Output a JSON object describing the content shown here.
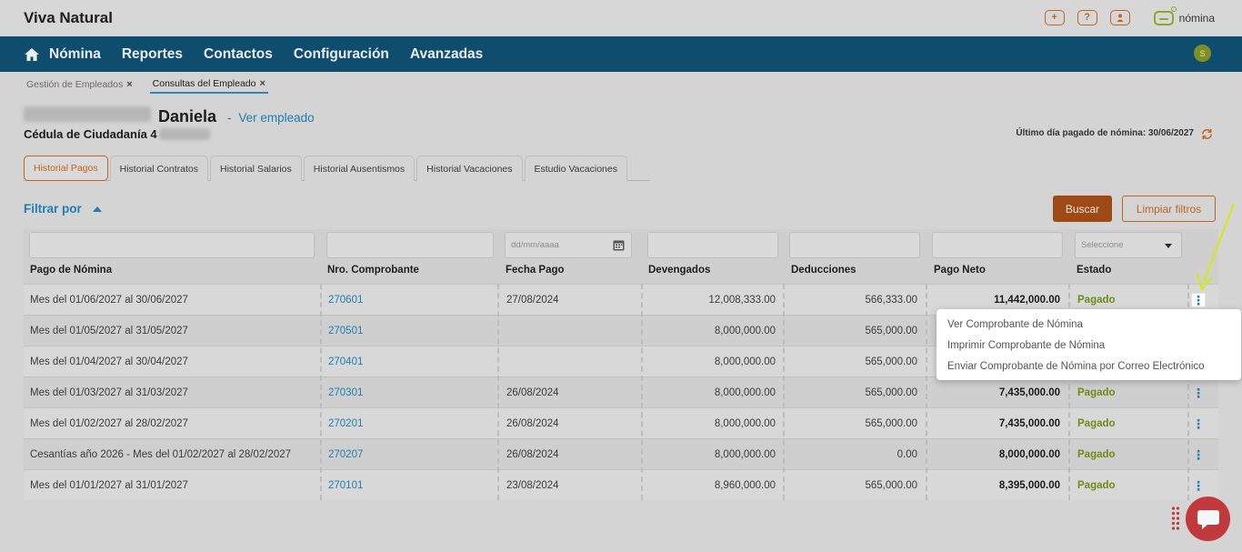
{
  "app": {
    "title": "Viva Natural",
    "product_label": "nómina"
  },
  "header_icons": [
    "plus-icon",
    "help-icon",
    "user-icon"
  ],
  "nav": {
    "items": [
      "Nómina",
      "Reportes",
      "Contactos",
      "Configuración",
      "Avanzadas"
    ],
    "badge": "S"
  },
  "breadcrumbs": [
    {
      "label": "Gestión de Empleados",
      "active": false
    },
    {
      "label": "Consultas del Empleado",
      "active": true
    }
  ],
  "employee": {
    "name_visible": "Daniela",
    "separator": "-",
    "view_link": "Ver empleado",
    "id_label": "Cédula de Ciudadanía 4",
    "last_paid": "Último día pagado de nómina: 30/06/2027"
  },
  "tabs": [
    "Historial Pagos",
    "Historial Contratos",
    "Historial Salarios",
    "Historial Ausentismos",
    "Historial Vacaciones",
    "Estudio Vacaciones"
  ],
  "active_tab": "Historial Pagos",
  "filters": {
    "title": "Filtrar por",
    "search_button": "Buscar",
    "clear_button": "Limpiar filtros",
    "date_placeholder": "dd/mm/aaaa",
    "select_placeholder": "Seleccione"
  },
  "table": {
    "columns": [
      "Pago de Nómina",
      "Nro. Comprobante",
      "Fecha Pago",
      "Devengados",
      "Deducciones",
      "Pago Neto",
      "Estado"
    ],
    "rows": [
      {
        "pago": "Mes del 01/06/2027 al 30/06/2027",
        "comprobante": "270601",
        "fecha": "27/08/2024",
        "devengados": "12,008,333.00",
        "deducciones": "566,333.00",
        "neto": "11,442,000.00",
        "estado": "Pagado"
      },
      {
        "pago": "Mes del 01/05/2027 al 31/05/2027",
        "comprobante": "270501",
        "fecha": "",
        "devengados": "8,000,000.00",
        "deducciones": "565,000.00",
        "neto": "",
        "estado": ""
      },
      {
        "pago": "Mes del 01/04/2027 al 30/04/2027",
        "comprobante": "270401",
        "fecha": "",
        "devengados": "8,000,000.00",
        "deducciones": "565,000.00",
        "neto": "",
        "estado": ""
      },
      {
        "pago": "Mes del 01/03/2027 al 31/03/2027",
        "comprobante": "270301",
        "fecha": "26/08/2024",
        "devengados": "8,000,000.00",
        "deducciones": "565,000.00",
        "neto": "7,435,000.00",
        "estado": "Pagado"
      },
      {
        "pago": "Mes del 01/02/2027 al 28/02/2027",
        "comprobante": "270201",
        "fecha": "26/08/2024",
        "devengados": "8,000,000.00",
        "deducciones": "565,000.00",
        "neto": "7,435,000.00",
        "estado": "Pagado"
      },
      {
        "pago": "Cesantías año 2026 - Mes del 01/02/2027 al 28/02/2027",
        "comprobante": "270207",
        "fecha": "26/08/2024",
        "devengados": "8,000,000.00",
        "deducciones": "0.00",
        "neto": "8,000,000.00",
        "estado": "Pagado"
      },
      {
        "pago": "Mes del 01/01/2027 al 31/01/2027",
        "comprobante": "270101",
        "fecha": "23/08/2024",
        "devengados": "8,960,000.00",
        "deducciones": "565,000.00",
        "neto": "8,395,000.00",
        "estado": "Pagado"
      }
    ]
  },
  "context_menu": {
    "items": [
      "Ver Comprobante de Nómina",
      "Imprimir Comprobante de Nómina",
      "Enviar Comprobante de Nómina por Correo Electrónico"
    ]
  },
  "colors": {
    "nav_bg": "#0f4d6e",
    "accent": "#c0651f",
    "link": "#1e7fb0",
    "status_paid": "#6f8a16",
    "arrow": "#d6e81a",
    "chat": "#c0393c"
  }
}
